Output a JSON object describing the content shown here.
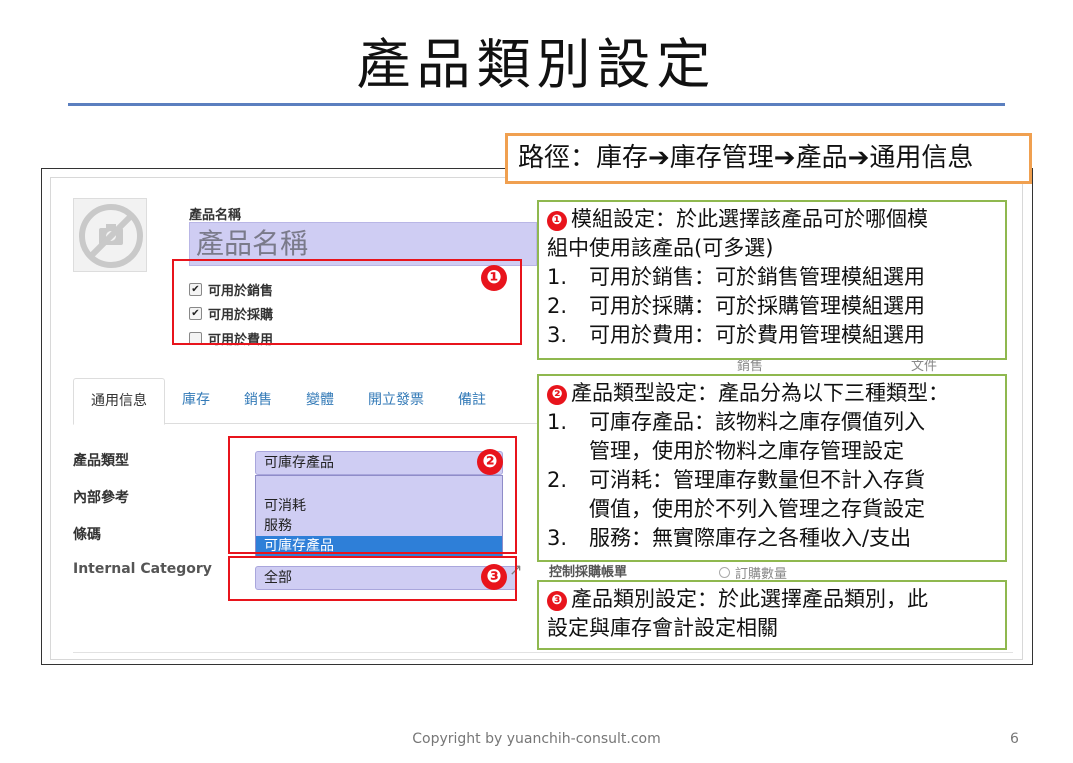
{
  "slide": {
    "title": "產品類別設定",
    "path": "路徑：庫存➔庫存管理➔產品➔通用信息",
    "footer": "Copyright by yuanchih-consult.com",
    "page_number": "6"
  },
  "form": {
    "product_name_label": "產品名稱",
    "product_name_placeholder": "產品名稱",
    "checkboxes": [
      {
        "label": "可用於銷售",
        "checked": true
      },
      {
        "label": "可用於採購",
        "checked": true
      },
      {
        "label": "可用於費用",
        "checked": false
      }
    ],
    "tabs": [
      "通用信息",
      "庫存",
      "銷售",
      "變體",
      "開立發票",
      "備註"
    ],
    "active_tab": "通用信息",
    "fields": {
      "product_type_label": "產品類型",
      "internal_ref_label": "內部參考",
      "barcode_label": "條碼",
      "internal_category_label": "Internal Category"
    },
    "product_type_value": "可庫存產品",
    "product_type_options": [
      "可消耗",
      "服務",
      "可庫存產品"
    ],
    "category_value": "全部",
    "partial_texts": {
      "sales": "銷售",
      "other": "文件",
      "control_policy": "控制採購帳單",
      "qty_option": "訂購數量"
    }
  },
  "badges": [
    "❶",
    "❷",
    "❸"
  ],
  "notes": {
    "note1": {
      "title": "模組設定：於此選擇該產品可於哪個模",
      "title2": "組中使用該產品(可多選)",
      "items": [
        {
          "num": "1.",
          "text": "可用於銷售：可於銷售管理模組選用"
        },
        {
          "num": "2.",
          "text": "可用於採購：可於採購管理模組選用"
        },
        {
          "num": "3.",
          "text": "可用於費用：可於費用管理模組選用"
        }
      ]
    },
    "note2": {
      "title": "產品類型設定：產品分為以下三種類型：",
      "items": [
        {
          "num": "1.",
          "text": "可庫存產品：該物料之庫存價值列入",
          "cont": "管理，使用於物料之庫存管理設定"
        },
        {
          "num": "2.",
          "text": "可消耗：管理庫存數量但不計入存貨",
          "cont": "價值，使用於不列入管理之存貨設定"
        },
        {
          "num": "3.",
          "text": "服務：無實際庫存之各種收入/支出",
          "cont": ""
        }
      ]
    },
    "note3": {
      "title": "產品類別設定：於此選擇產品類別，此",
      "title2": "設定與庫存會計設定相關"
    }
  },
  "colors": {
    "highlight_red": "#e8141c",
    "note_border": "#8fb84f",
    "path_border": "#f0a050",
    "title_rule": "#5b7fbf",
    "input_fill": "#cfcdf3",
    "selected_option": "#2e7fd8"
  }
}
